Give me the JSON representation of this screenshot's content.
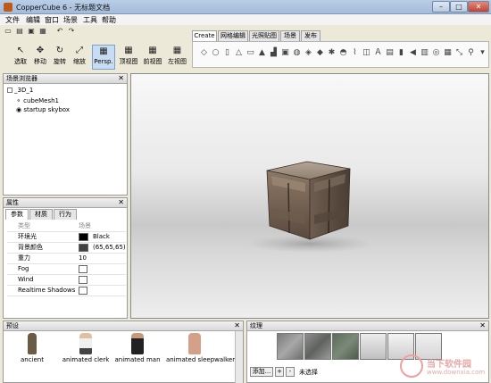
{
  "window": {
    "title": "CopperCube 6 - 无标题文档",
    "controls": {
      "minimize": "–",
      "maximize": "□",
      "close": "✕"
    }
  },
  "menu": [
    "文件",
    "编辑",
    "窗口",
    "场景",
    "工具",
    "帮助"
  ],
  "toolbar": {
    "tools": [
      {
        "label": "选取",
        "icon": "pointer-icon"
      },
      {
        "label": "移动",
        "icon": "move-icon"
      },
      {
        "label": "旋转",
        "icon": "rotate-icon"
      },
      {
        "label": "缩放",
        "icon": "scale-icon"
      },
      {
        "label": "Persp.",
        "icon": "perspective-icon",
        "active": true
      },
      {
        "label": "顶视图",
        "icon": "top-view-icon"
      },
      {
        "label": "前视图",
        "icon": "front-view-icon"
      },
      {
        "label": "左视图",
        "icon": "left-view-icon"
      }
    ]
  },
  "create_panel": {
    "tabs": [
      "Create",
      "网格编辑",
      "光照贴图",
      "场景",
      "发布"
    ],
    "active_tab": "Create"
  },
  "scene_browser": {
    "title": "场景浏览器",
    "nodes": [
      "_3D_1",
      "cubeMesh1",
      "startup skybox"
    ]
  },
  "properties": {
    "title": "属性",
    "tabs": [
      "参数",
      "材质",
      "行为"
    ],
    "active_tab": "参数",
    "header": {
      "key": "类型",
      "value": "场景"
    },
    "rows": [
      {
        "key": "环境光",
        "value": "Black",
        "swatch": "#000000"
      },
      {
        "key": "背景颜色",
        "value": "(65,65,65)",
        "swatch": "#414141"
      },
      {
        "key": "重力",
        "value": "10"
      },
      {
        "key": "Fog",
        "checkbox": true
      },
      {
        "key": "Wind",
        "checkbox": true
      },
      {
        "key": "Realtime Shadows",
        "checkbox": true
      }
    ]
  },
  "presets": {
    "title": "预设",
    "items": [
      "ancient",
      "animated clerk",
      "animated man",
      "animated sleepwalker"
    ]
  },
  "textures": {
    "title": "纹理",
    "add_label": "添加...",
    "plus": "+",
    "minus": "-",
    "selection": "未选择"
  },
  "watermark": {
    "text": "当下软件园",
    "url": "www.downxia.com"
  },
  "colors": {
    "title_bar": "#a4bcd9",
    "cube_metal": "#7a6655",
    "viewport_bg": "#e0e0e0"
  }
}
